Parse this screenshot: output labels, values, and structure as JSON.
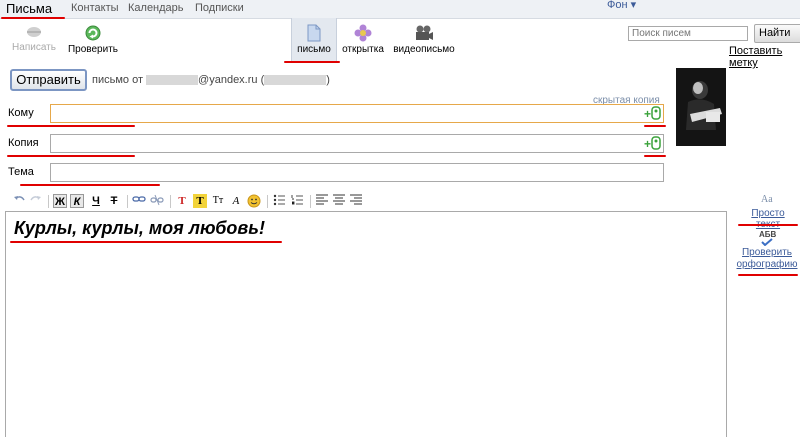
{
  "nav": {
    "tabs": [
      "Письма",
      "Контакты",
      "Календарь",
      "Подписки"
    ],
    "theme": "Фон ▾"
  },
  "toolbar": {
    "write": "Написать",
    "check": "Проверить",
    "letter": "письмо",
    "postcard": "открытка",
    "video": "видеописьмо",
    "search_placeholder": "Поиск писем",
    "search_button": "Найти",
    "set_label": "Поставить метку"
  },
  "compose": {
    "send": "Отправить",
    "from_prefix": "письмо от",
    "from_email": "@yandex.ru (",
    "from_suffix": ")",
    "hidden_copy": "скрытая копия",
    "to_label": "Кому",
    "cc_label": "Копия",
    "subject_label": "Тема",
    "add_contact": "+",
    "body": "Курлы, курлы, моя любовь!"
  },
  "editor_toolbar": {
    "bold": "Ж",
    "italic": "К",
    "underline": "Ч",
    "strike": "Т",
    "text_color": "Т",
    "bg_color": "Т",
    "font_size": "Тт",
    "font": "А"
  },
  "side": {
    "plain_text_icon": "Aa",
    "plain_text": "Просто текст",
    "spell_icon": "АБВ",
    "spell_check": "Проверить орфографию"
  },
  "colors": {
    "accent": "#3c5b99",
    "highlight": "#e00000",
    "nav_bg": "#eef1f5"
  }
}
